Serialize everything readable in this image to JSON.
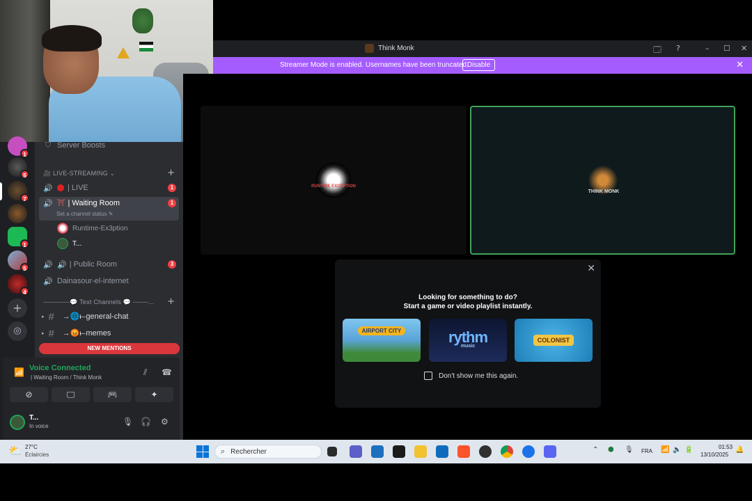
{
  "window": {
    "title": "Think Monk"
  },
  "banner": {
    "message": "Streamer Mode is enabled. Usernames have been truncated.",
    "disable_label": "Disable"
  },
  "sidebar": {
    "server_boosts": "Server Boosts",
    "category_live": "LIVE-STREAMING",
    "channels": [
      {
        "label": "| LIVE",
        "badge": "1"
      },
      {
        "label": "| Waiting Room",
        "badge": "1",
        "status": "Set a channel status"
      },
      {
        "label": "| Public Room",
        "badge": "3"
      },
      {
        "label": "Dainasour-el-internet"
      }
    ],
    "voice_users": [
      "Runtime-Ex3ption",
      "T..."
    ],
    "category_text": "------------💬 Text Channels 💬 -------...",
    "text_channels": [
      "→🌐⟝general-chat",
      "→😡⟝memes"
    ],
    "new_mentions": "NEW MENTIONS",
    "server_badges": [
      "1",
      "5",
      "7",
      "1",
      "5",
      "4"
    ]
  },
  "voice_panel": {
    "title": "Voice Connected",
    "subtitle": "| Waiting Room / Think Monk"
  },
  "user": {
    "name": "T...",
    "status": "In voice"
  },
  "stage": {
    "left_tile_label": "RUNTIME EXCEPTION",
    "right_tile_label": "THINK MONK"
  },
  "activity": {
    "heading": "Looking for something to do?",
    "subheading": "Start a game or video playlist instantly.",
    "cards": [
      "AIRPORT CITY",
      "rythm",
      "COLONIST"
    ],
    "card_sub": "music",
    "dont_show": "Don't show me this again."
  },
  "taskbar": {
    "temp": "27°C",
    "weather": "Éclaircies",
    "search_placeholder": "Rechercher",
    "lang": "FRA",
    "time": "01:53",
    "date": "13/10/2025"
  }
}
